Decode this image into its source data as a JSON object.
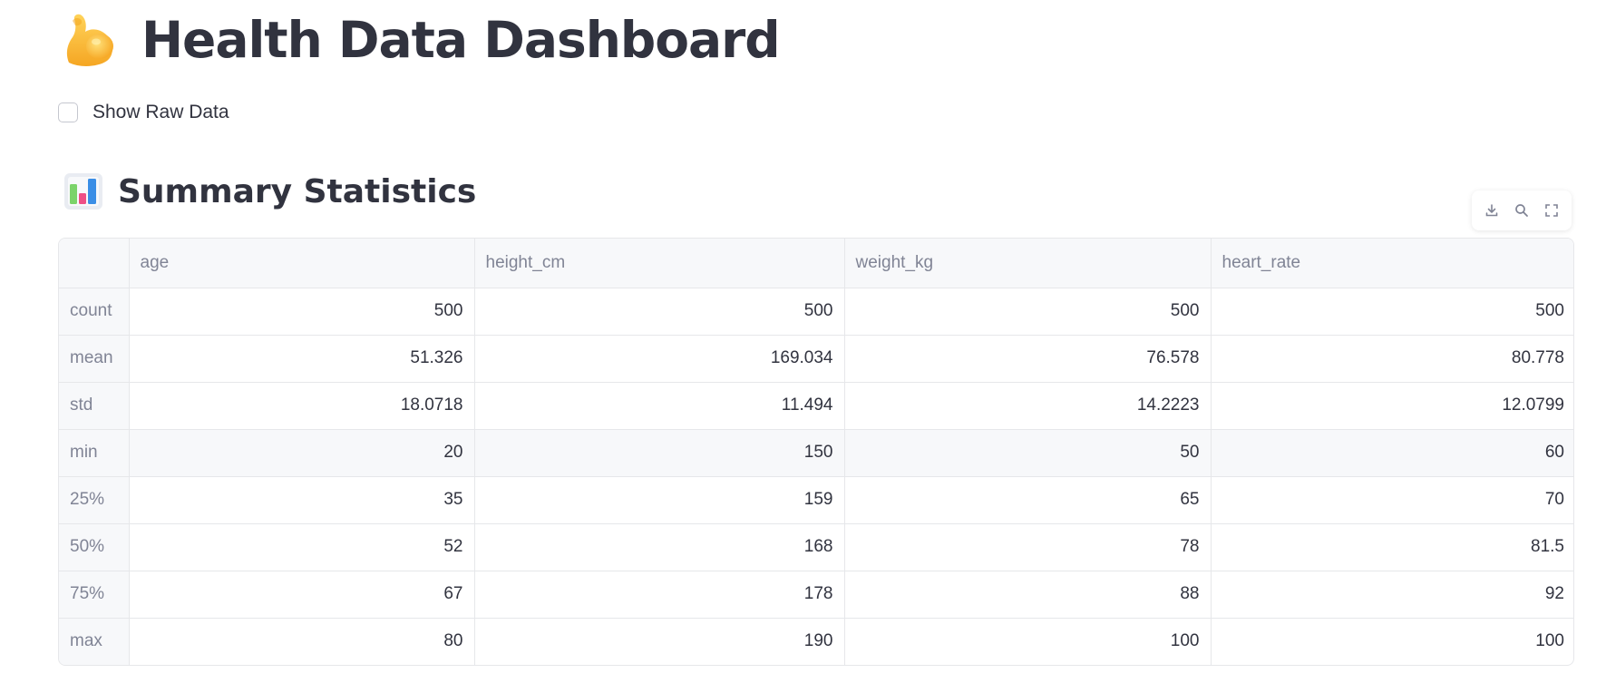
{
  "header": {
    "title": "Health Data Dashboard",
    "title_icon": "flexed-biceps-emoji"
  },
  "raw_data_toggle": {
    "label": "Show Raw Data",
    "checked": false
  },
  "summary": {
    "title": "Summary Statistics",
    "title_icon": "bar-chart-emoji"
  },
  "toolbar": {
    "icons": [
      "download-icon",
      "search-icon",
      "fullscreen-icon"
    ]
  },
  "table": {
    "columns": [
      "",
      "age",
      "height_cm",
      "weight_kg",
      "heart_rate"
    ],
    "rows": [
      {
        "label": "count",
        "values": [
          "500",
          "500",
          "500",
          "500"
        ]
      },
      {
        "label": "mean",
        "values": [
          "51.326",
          "169.034",
          "76.578",
          "80.778"
        ]
      },
      {
        "label": "std",
        "values": [
          "18.0718",
          "11.494",
          "14.2223",
          "12.0799"
        ]
      },
      {
        "label": "min",
        "values": [
          "20",
          "150",
          "50",
          "60"
        ]
      },
      {
        "label": "25%",
        "values": [
          "35",
          "159",
          "65",
          "70"
        ]
      },
      {
        "label": "50%",
        "values": [
          "52",
          "168",
          "78",
          "81.5"
        ]
      },
      {
        "label": "75%",
        "values": [
          "67",
          "178",
          "88",
          "92"
        ]
      },
      {
        "label": "max",
        "values": [
          "80",
          "190",
          "100",
          "100"
        ]
      }
    ]
  },
  "colors": {
    "text": "#31333f",
    "muted": "#808495",
    "border": "#e6e7ea",
    "header_bg": "#f7f8fa"
  }
}
